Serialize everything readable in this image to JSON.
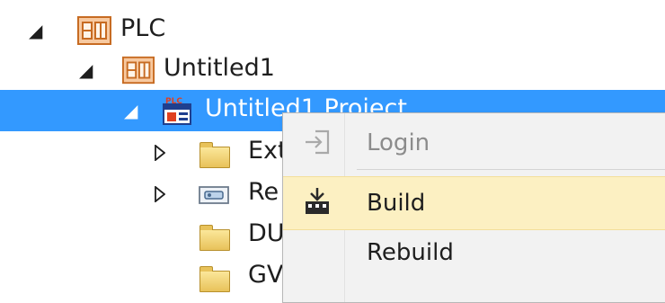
{
  "tree": {
    "items": [
      {
        "label": "PLC",
        "expanded": true
      },
      {
        "label": "Untitled1",
        "expanded": true
      },
      {
        "label": "Untitled1 Project",
        "expanded": true,
        "selected": true,
        "visible_label": "Untitled1 Project"
      },
      {
        "label": "Ext",
        "expanded": false
      },
      {
        "label": "Re",
        "expanded": false
      },
      {
        "label": "DU"
      },
      {
        "label": "GV"
      }
    ],
    "icons": {
      "plc": "plc-icon",
      "project": "plc-project-icon",
      "folder": "folder-icon",
      "references": "references-icon"
    },
    "selection_color": "#3399ff"
  },
  "context_menu": {
    "items": [
      {
        "label": "Login",
        "icon": "login-icon",
        "enabled": false
      },
      {
        "label": "Build",
        "icon": "build-icon",
        "enabled": true,
        "hovered": true
      },
      {
        "label": "Rebuild",
        "icon": "",
        "enabled": true
      }
    ],
    "hover_color": "#fcf0c2"
  }
}
